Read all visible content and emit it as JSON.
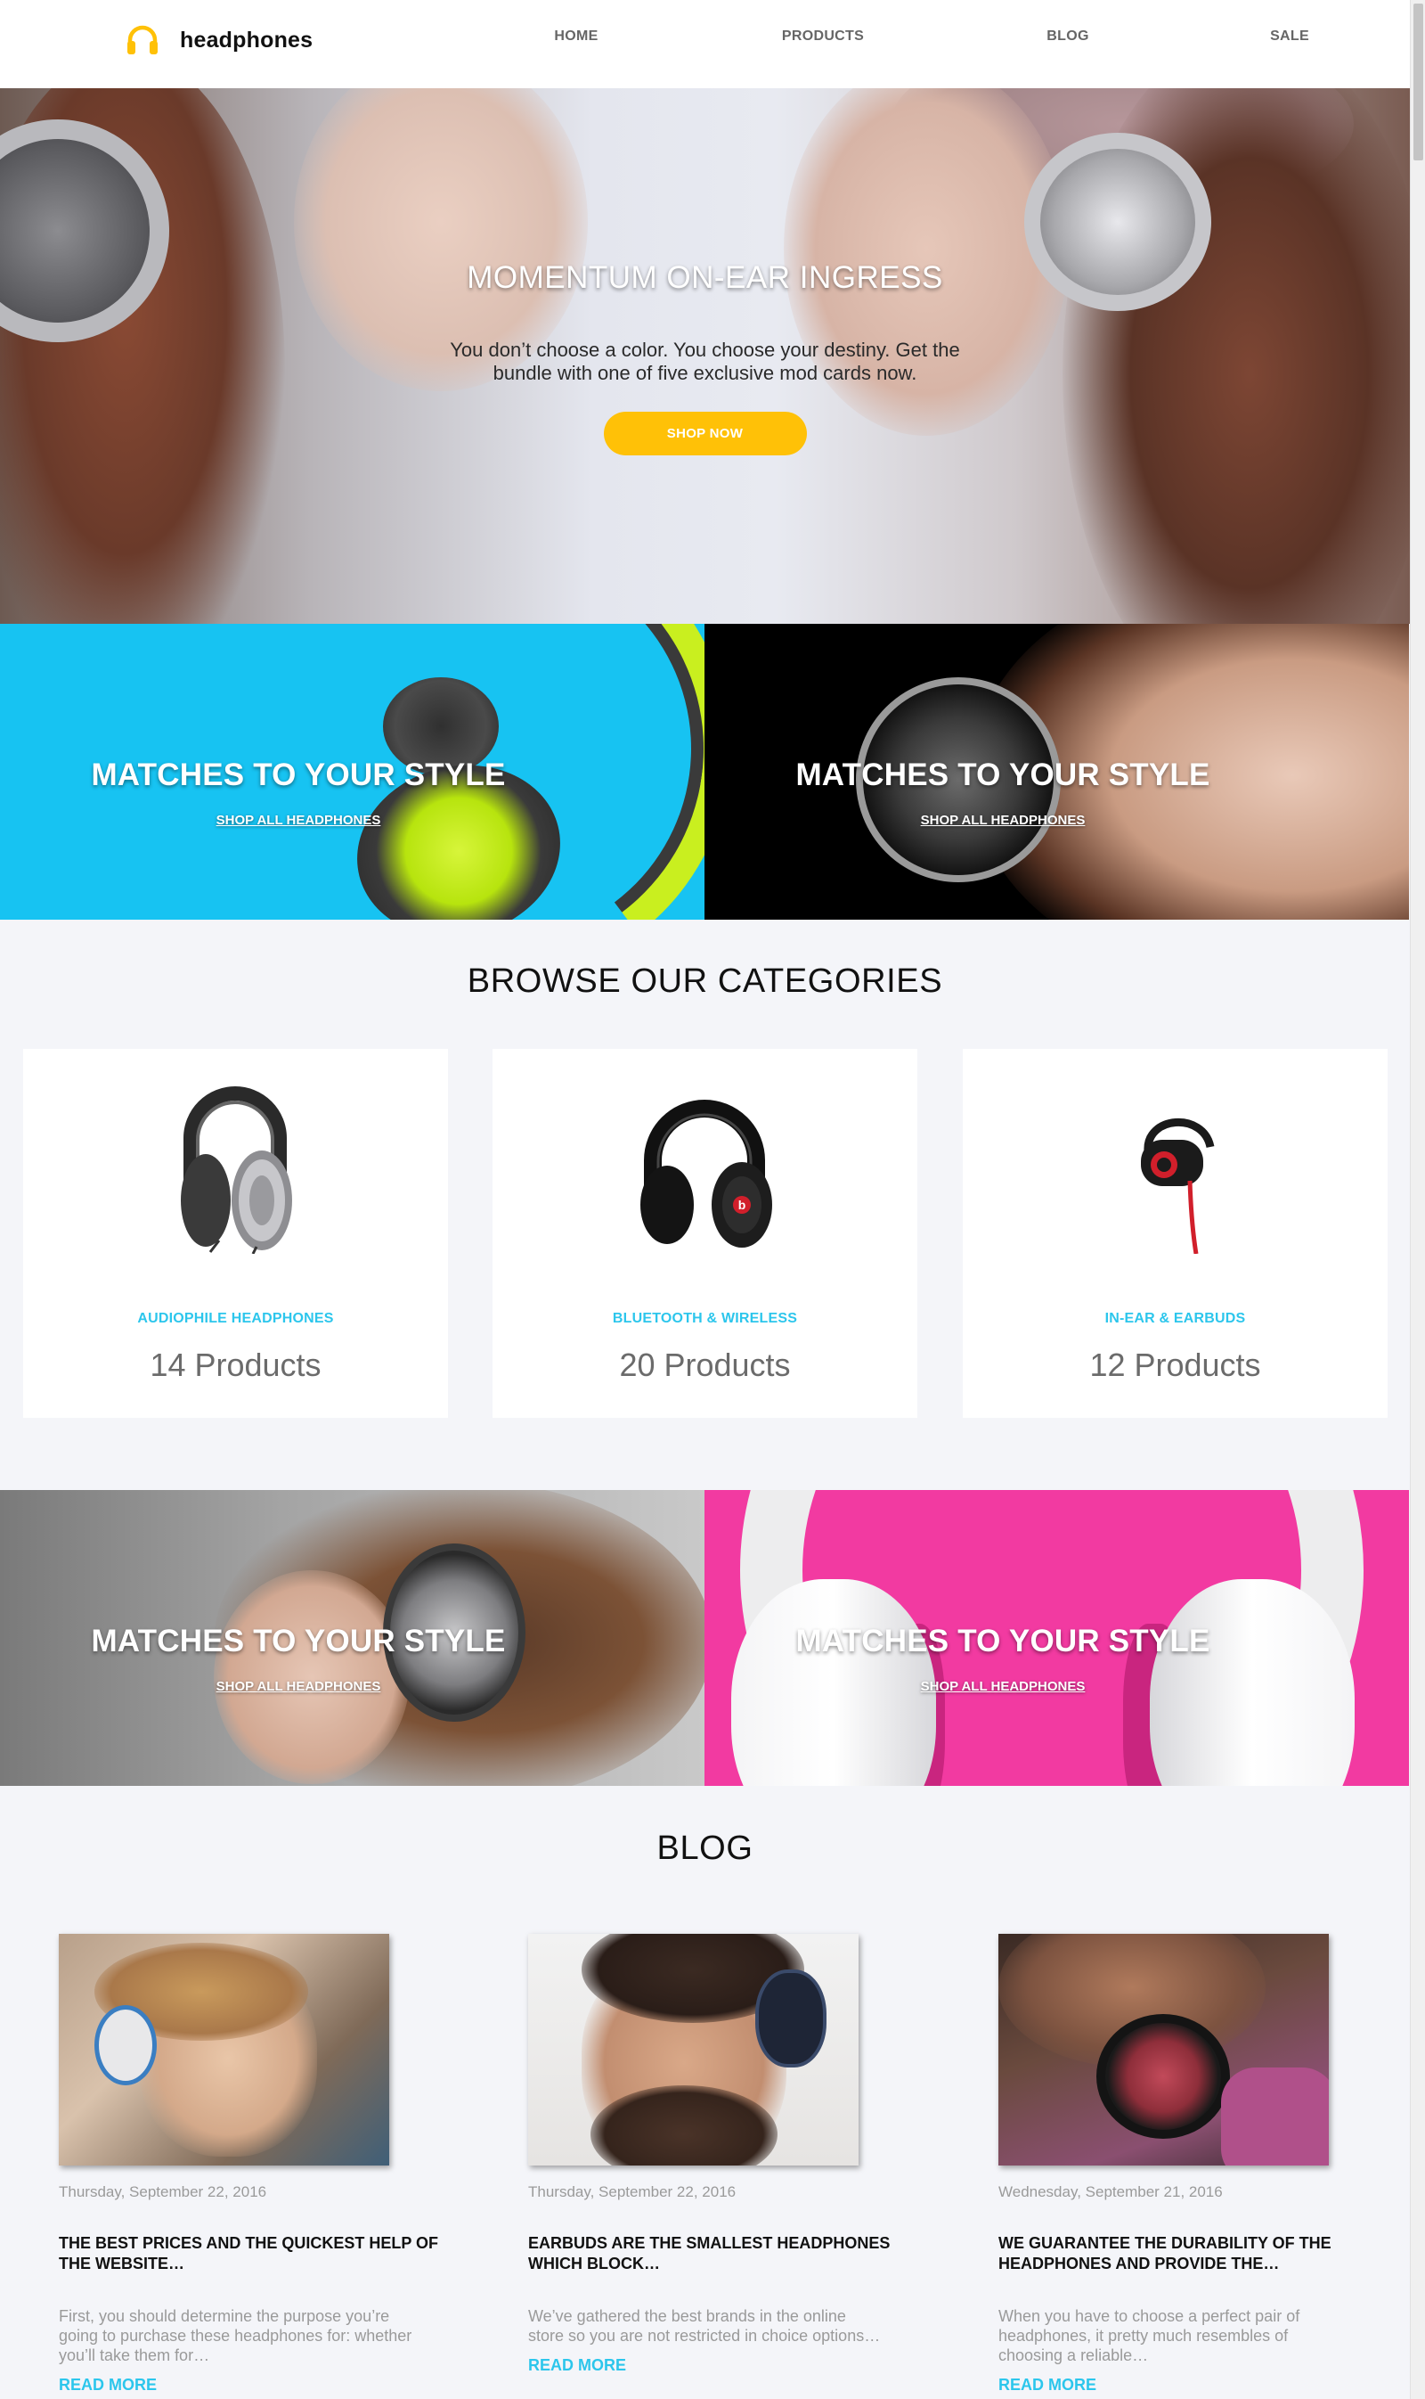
{
  "brand": {
    "name": "headphones",
    "accent": "#ffc107",
    "link_color": "#2cc6ec"
  },
  "nav": [
    {
      "label": "HOME"
    },
    {
      "label": "PRODUCTS"
    },
    {
      "label": "BLOG"
    },
    {
      "label": "SALE"
    }
  ],
  "hero": {
    "title": "MOMENTUM ON-EAR INGRESS",
    "subtitle": "You don’t choose a color. You choose your destiny. Get the bundle with one of five exclusive mod cards now.",
    "button": "SHOP NOW"
  },
  "promos": [
    {
      "title": "MATCHES TO YOUR STYLE",
      "link": "SHOP ALL HEADPHONES",
      "bg": "#17c3f2"
    },
    {
      "title": "MATCHES TO YOUR STYLE",
      "link": "SHOP ALL HEADPHONES",
      "bg": "#000000"
    },
    {
      "title": "MATCHES TO YOUR STYLE",
      "link": "SHOP ALL HEADPHONES",
      "bg": "#a4a4a4"
    },
    {
      "title": "MATCHES TO YOUR STYLE",
      "link": "SHOP ALL HEADPHONES",
      "bg": "#f23aa1"
    }
  ],
  "categories": {
    "title": "BROWSE OUR CATEGORIES",
    "items": [
      {
        "name": "AUDIOPHILE HEADPHONES",
        "count": "14 Products",
        "icon": "over-ear-headphones-icon"
      },
      {
        "name": "BLUETOOTH & WIRELESS",
        "count": "20 Products",
        "icon": "wireless-headphones-icon"
      },
      {
        "name": "IN-EAR & EARBUDS",
        "count": "12 Products",
        "icon": "earbud-icon"
      }
    ]
  },
  "blog": {
    "title": "BLOG",
    "posts": [
      {
        "date": "Thursday, September 22, 2016",
        "title": "THE BEST PRICES AND THE QUICKEST HELP OF THE WEBSITE…",
        "excerpt": "First, you should determine the purpose you’re going to purchase these headphones for: whether you’ll take them for…",
        "more": "READ MORE"
      },
      {
        "date": "Thursday, September 22, 2016",
        "title": "EARBUDS ARE THE SMALLEST HEADPHONES WHICH BLOCK…",
        "excerpt": "We’ve gathered the best brands in the online store so you are not restricted in choice options…",
        "more": "READ MORE"
      },
      {
        "date": "Wednesday, September 21, 2016",
        "title": "WE GUARANTEE THE DURABILITY OF THE HEADPHONES AND PROVIDE THE…",
        "excerpt": "When you have to choose a perfect pair of headphones, it pretty much resembles of choosing a reliable…",
        "more": "READ MORE"
      }
    ]
  }
}
